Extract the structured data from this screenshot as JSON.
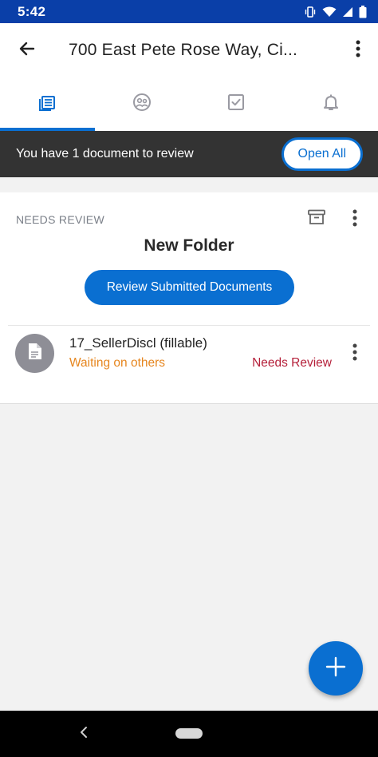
{
  "status_bar": {
    "time": "5:42",
    "icons": [
      "vibrate-icon",
      "wifi-icon",
      "cellular-signal-icon",
      "battery-icon"
    ]
  },
  "app_bar": {
    "title": "700 East Pete Rose Way, Ci..."
  },
  "tabs": [
    {
      "icon": "documents-icon",
      "active": true
    },
    {
      "icon": "contacts-icon",
      "active": false
    },
    {
      "icon": "tasks-checkbox-icon",
      "active": false
    },
    {
      "icon": "notifications-bell-icon",
      "active": false
    }
  ],
  "banner": {
    "text": "You have 1 document to review",
    "button_label": "Open All"
  },
  "folder": {
    "section_label": "NEEDS REVIEW",
    "title": "New Folder",
    "review_button_label": "Review Submitted Documents",
    "documents": [
      {
        "name": "17_SellerDiscl (fillable)",
        "substatus": "Waiting on others",
        "status": "Needs Review"
      }
    ]
  },
  "colors": {
    "brand_blue": "#0a6fd1",
    "status_bar": "#0a3fa8",
    "banner_bg": "#333333",
    "waiting_orange": "#e6861f",
    "needs_review_red": "#b5203a"
  }
}
